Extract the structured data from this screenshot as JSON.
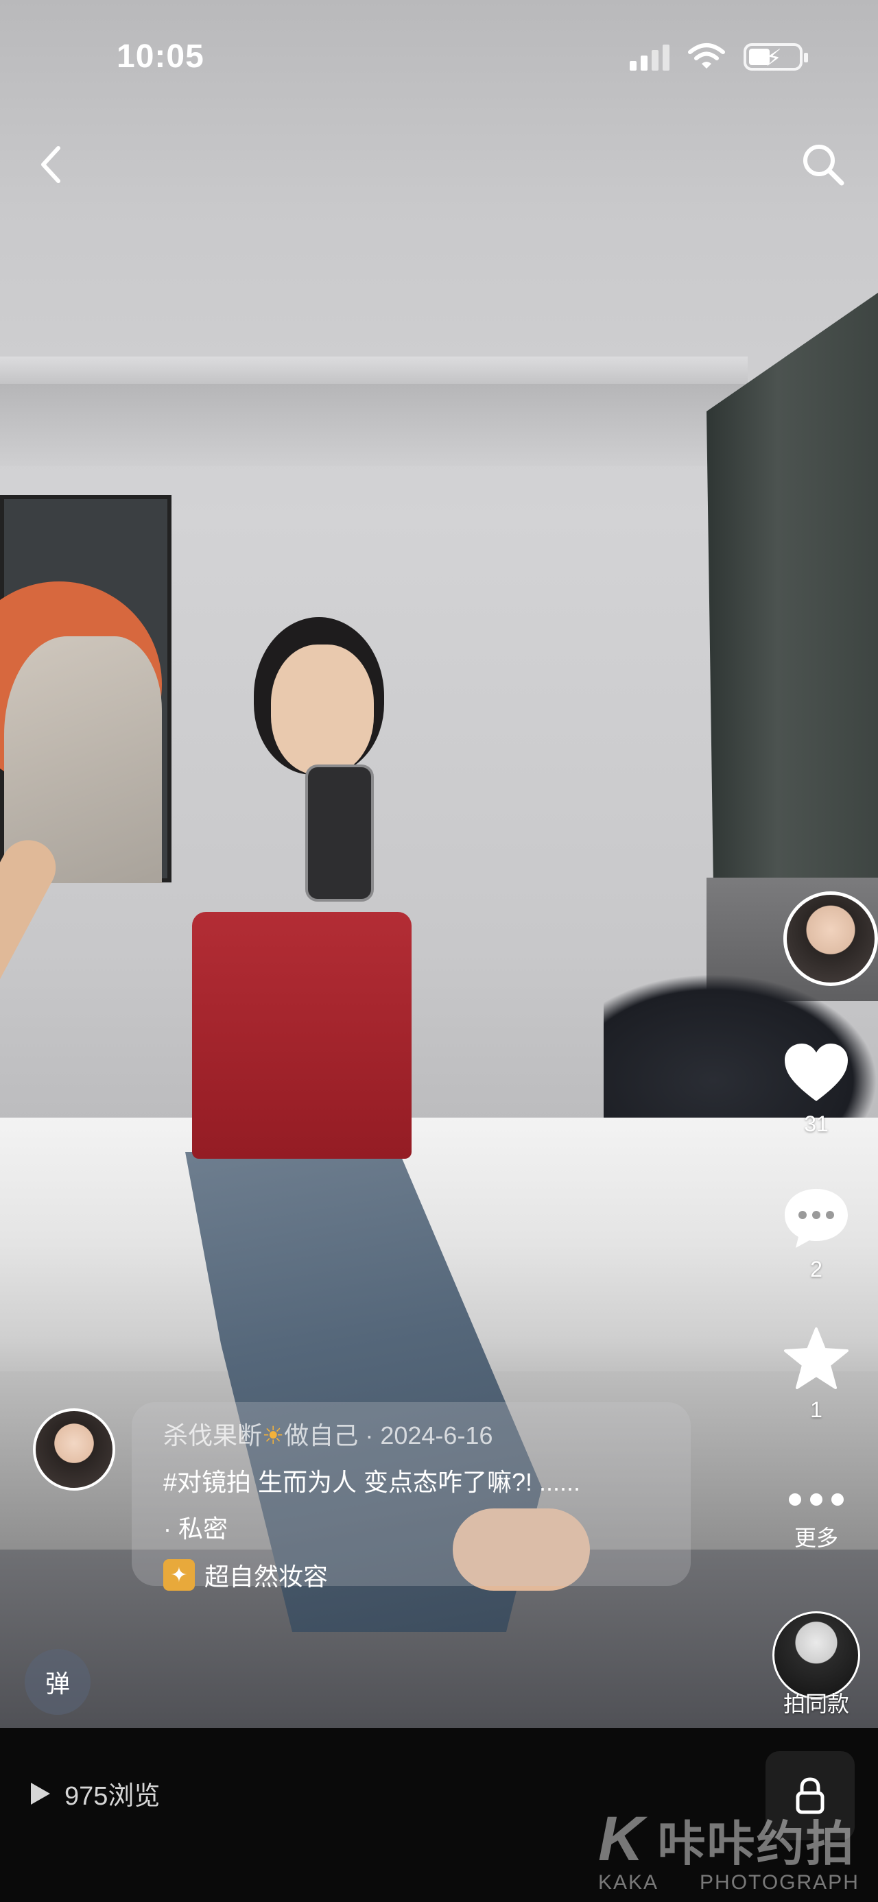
{
  "status": {
    "time": "10:05"
  },
  "nav": {
    "back_icon": "chevron-left-icon",
    "search_icon": "search-icon"
  },
  "rail": {
    "likes": "31",
    "comments": "2",
    "favorites": "1",
    "more_label": "更多",
    "same_label": "拍同款"
  },
  "caption": {
    "author": "杀伐果断",
    "author_suffix": "做自己",
    "separator": "·",
    "date": "2024-6-16",
    "text": "#对镜拍 生而为人 变点态咋了嘛?! ......",
    "privacy": "· 私密",
    "tag": "超自然妆容"
  },
  "danmu": {
    "label": "弹"
  },
  "bottom": {
    "views": "975浏览"
  },
  "watermark": {
    "mark": "K",
    "brand": "咔咔约拍",
    "sub_left": "KAKA",
    "sub_right": "PHOTOGRAPH"
  },
  "colors": {
    "tag_accent": "#e8a93b",
    "bottom_bar": "#0a0a0a"
  }
}
